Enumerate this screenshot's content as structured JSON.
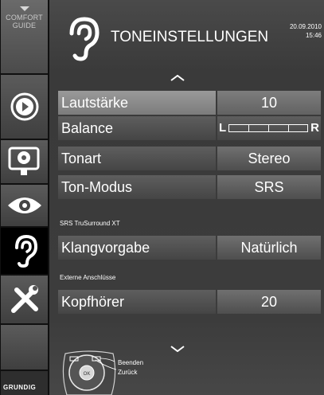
{
  "sidebar": {
    "guide_line1": "COMFORT",
    "guide_line2": "GUIDE",
    "brand": "GRUNDIG"
  },
  "header": {
    "title": "TONEINSTELLUNGEN",
    "date": "20.09.2010",
    "time": "15:46"
  },
  "rows": [
    {
      "label": "Lautstärke",
      "value": "10"
    },
    {
      "label": "Balance",
      "left_mark": "L",
      "right_mark": "R",
      "balance_position": 0.5
    },
    {
      "label": "Tonart",
      "value": "Stereo"
    },
    {
      "label": "Ton-Modus",
      "value": "SRS"
    }
  ],
  "section_srs": "SRS TruSurround XT",
  "srs_row": {
    "label": "Klangvorgabe",
    "value": "Natürlich"
  },
  "section_ext": "Externe Anschlüsse",
  "ext_row": {
    "label": "Kopfhörer",
    "value": "20"
  },
  "help": {
    "ok_label": "OK",
    "exit": "Beenden",
    "back": "Zurück"
  },
  "colors": {
    "accent": "#ffffff",
    "selected": "#9a9a9a"
  }
}
